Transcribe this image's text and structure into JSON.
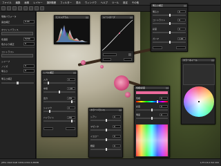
{
  "menubar": {
    "items": [
      "ファイル",
      "編集",
      "画像",
      "レイヤー",
      "選択範囲",
      "フィルター",
      "表示",
      "ウィンドウ",
      "ヘルプ",
      "ツール",
      "設定",
      "その他"
    ]
  },
  "sidebar": {
    "rows": [
      {
        "label": "現像パラメータ",
        "value": ""
      },
      {
        "label": "露出補正",
        "value": "0.00"
      },
      {
        "label": "ホワイトバランス",
        "value": ""
      },
      {
        "label": "色温度",
        "value": "5200"
      },
      {
        "label": "色かぶり補正",
        "value": "0"
      },
      {
        "label": "コントラスト",
        "value": ""
      },
      {
        "label": "シャープ",
        "value": ""
      },
      {
        "label": "ノイズ",
        "value": "0"
      },
      {
        "label": "明るさ",
        "value": "0"
      }
    ],
    "lower_label": "明るさ補正"
  },
  "panels": {
    "histogram": {
      "title": "ヒストグラム"
    },
    "curve": {
      "title": "トーンカーブ"
    },
    "top_right": {
      "title": "明るさ補正",
      "rows": [
        {
          "label": "明るさ",
          "value": "0"
        },
        {
          "label": "コントラスト",
          "value": "0"
        },
        {
          "label": "彩度",
          "value": "0"
        },
        {
          "label": "ガンマ",
          "value": "1.00"
        }
      ]
    },
    "left_mid": {
      "title": "レベル補正",
      "rows": [
        {
          "label": "入力",
          "value": "0"
        },
        {
          "label": "中間",
          "value": "1.00"
        },
        {
          "label": "出力",
          "value": "255"
        },
        {
          "label": "シャドウ",
          "value": "0"
        },
        {
          "label": "ハイライト",
          "value": "255"
        }
      ]
    },
    "center_bottom": {
      "title": "カラーバランス",
      "rows": [
        {
          "label": "シアン",
          "value": "0"
        },
        {
          "label": "マゼンタ",
          "value": "0"
        },
        {
          "label": "イエロー",
          "value": "0"
        },
        {
          "label": "輝度",
          "value": "0"
        }
      ]
    },
    "color_picker": {
      "title": "色相/彩度",
      "rows": [
        {
          "label": "色相",
          "value": "0"
        },
        {
          "label": "彩度",
          "value": "0"
        },
        {
          "label": "明度",
          "value": "0"
        }
      ]
    },
    "color_wheel": {
      "title": "カラーホイール"
    }
  },
  "status": {
    "left": "JPEG  16bit  RGB  3456×2304  6.85MB",
    "right": "1/75  f/4.0  ISO 200"
  },
  "colors": {
    "accent": "#d65484",
    "panel": "#262626",
    "background": "#1b1b1b"
  }
}
